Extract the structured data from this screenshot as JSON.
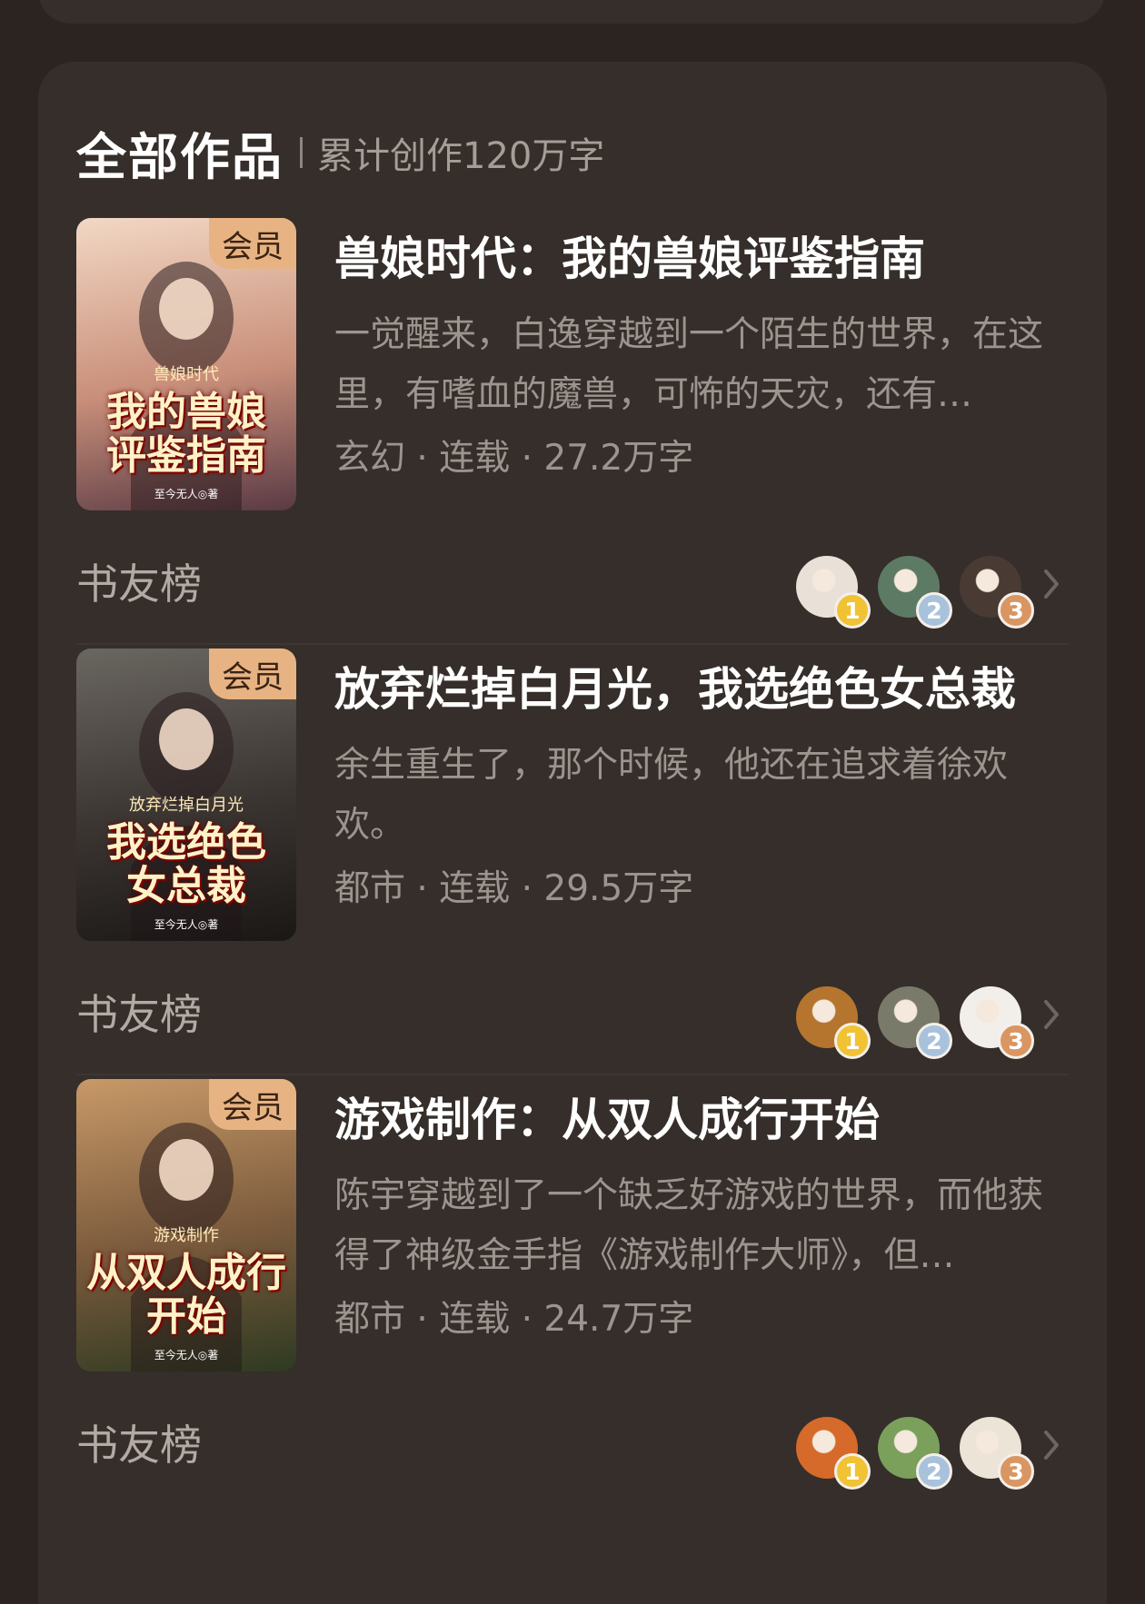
{
  "header": {
    "title": "全部作品",
    "subtitle": "累计创作120万字"
  },
  "books": [
    {
      "badge": "会员",
      "title": "兽娘时代：我的兽娘评鉴指南",
      "description": "一觉醒来，白逸穿越到一个陌生的世界，在这里，有嗜血的魔兽，可怖的天灾，还有…",
      "meta": "玄幻 · 连载 · 27.2万字",
      "cover": {
        "title_lines": [
          "我的兽娘",
          "评鉴指南"
        ],
        "subtitle": "兽娘时代",
        "author": "至今无人◎著",
        "colors": [
          "#f2d8c4",
          "#c98f7a",
          "#5a3a44"
        ]
      },
      "rank_label": "书友榜",
      "readers": [
        {
          "rank": "1",
          "color": "#e9e1d8"
        },
        {
          "rank": "2",
          "color": "#5c7a64"
        },
        {
          "rank": "3",
          "color": "#4a3a34"
        }
      ]
    },
    {
      "badge": "会员",
      "title": "放弃烂掉白月光，我选绝色女总裁",
      "description": "余生重生了，那个时候，他还在追求着徐欢欢。",
      "meta": "都市 · 连载 · 29.5万字",
      "cover": {
        "title_lines": [
          "我选绝色",
          "女总裁"
        ],
        "subtitle": "放弃烂掉白月光",
        "author": "至今无人◎著",
        "colors": [
          "#6a6660",
          "#3b3532",
          "#1a1715"
        ]
      },
      "rank_label": "书友榜",
      "readers": [
        {
          "rank": "1",
          "color": "#b5752e"
        },
        {
          "rank": "2",
          "color": "#7a7a6a"
        },
        {
          "rank": "3",
          "color": "#f2efea"
        }
      ]
    },
    {
      "badge": "会员",
      "title": "游戏制作：从双人成行开始",
      "description": "陈宇穿越到了一个缺乏好游戏的世界，而他获得了神级金手指《游戏制作大师》，但…",
      "meta": "都市 · 连载 · 24.7万字",
      "cover": {
        "title_lines": [
          "从双人成行",
          "开始"
        ],
        "subtitle": "游戏制作",
        "author": "至今无人◎著",
        "colors": [
          "#c89968",
          "#7a5a3c",
          "#2e3a22"
        ]
      },
      "rank_label": "书友榜",
      "readers": [
        {
          "rank": "1",
          "color": "#d56a2a"
        },
        {
          "rank": "2",
          "color": "#7aa05c"
        },
        {
          "rank": "3",
          "color": "#ece4d6"
        }
      ]
    }
  ]
}
